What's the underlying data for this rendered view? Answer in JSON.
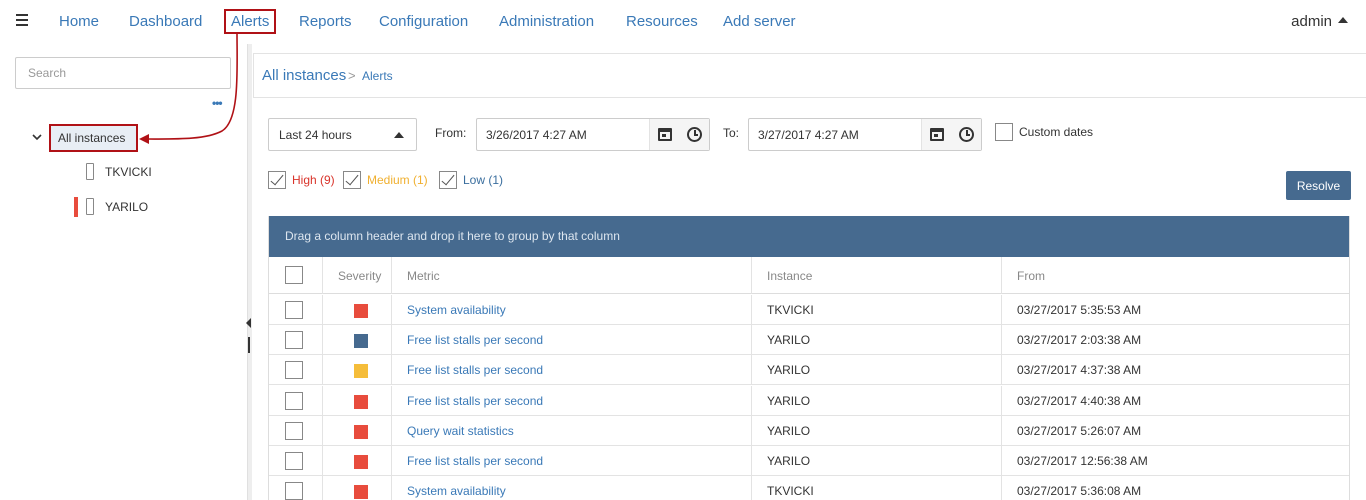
{
  "nav": {
    "items": [
      "Home",
      "Dashboard",
      "Alerts",
      "Reports",
      "Configuration",
      "Administration",
      "Resources",
      "Add server"
    ],
    "active": "Alerts",
    "user": "admin"
  },
  "sidebar": {
    "search_placeholder": "Search",
    "more": "•••",
    "root": "All instances",
    "servers": [
      {
        "name": "TKVICKI",
        "has_alert": false
      },
      {
        "name": "YARILO",
        "has_alert": true
      }
    ]
  },
  "breadcrumb": {
    "root": "All instances",
    "separator": ">",
    "current": "Alerts"
  },
  "filters": {
    "range": "Last 24 hours",
    "from_label": "From:",
    "from_value": "3/26/2017 4:27 AM",
    "to_label": "To:",
    "to_value": "3/27/2017 4:27 AM",
    "custom_dates_label": "Custom dates",
    "custom_dates_checked": false,
    "severity": [
      {
        "label": "High (9)",
        "color": "#d9342b",
        "checked": true
      },
      {
        "label": "Medium (1)",
        "color": "#f0b030",
        "checked": true
      },
      {
        "label": "Low (1)",
        "color": "#3a6e9e",
        "checked": true
      }
    ]
  },
  "resolve_label": "Resolve",
  "grid": {
    "group_hint": "Drag a column header and drop it here to group by that column",
    "columns": [
      "Severity",
      "Metric",
      "Instance",
      "From"
    ],
    "rows": [
      {
        "severity": "high",
        "metric": "System availability",
        "instance": "TKVICKI",
        "from": "03/27/2017 5:35:53 AM"
      },
      {
        "severity": "low",
        "metric": "Free list stalls per second",
        "instance": "YARILO",
        "from": "03/27/2017 2:03:38 AM"
      },
      {
        "severity": "medium",
        "metric": "Free list stalls per second",
        "instance": "YARILO",
        "from": "03/27/2017 4:37:38 AM"
      },
      {
        "severity": "high",
        "metric": "Free list stalls per second",
        "instance": "YARILO",
        "from": "03/27/2017 4:40:38 AM"
      },
      {
        "severity": "high",
        "metric": "Query wait statistics",
        "instance": "YARILO",
        "from": "03/27/2017 5:26:07 AM"
      },
      {
        "severity": "high",
        "metric": "Free list stalls per second",
        "instance": "YARILO",
        "from": "03/27/2017 12:56:38 AM"
      },
      {
        "severity": "high",
        "metric": "System availability",
        "instance": "TKVICKI",
        "from": "03/27/2017 5:36:08 AM"
      }
    ]
  },
  "colors": {
    "high": "#e84c3d",
    "medium": "#f5bd3a",
    "low": "#466a8f",
    "link": "#3a79b7",
    "annotation": "#b01116"
  }
}
